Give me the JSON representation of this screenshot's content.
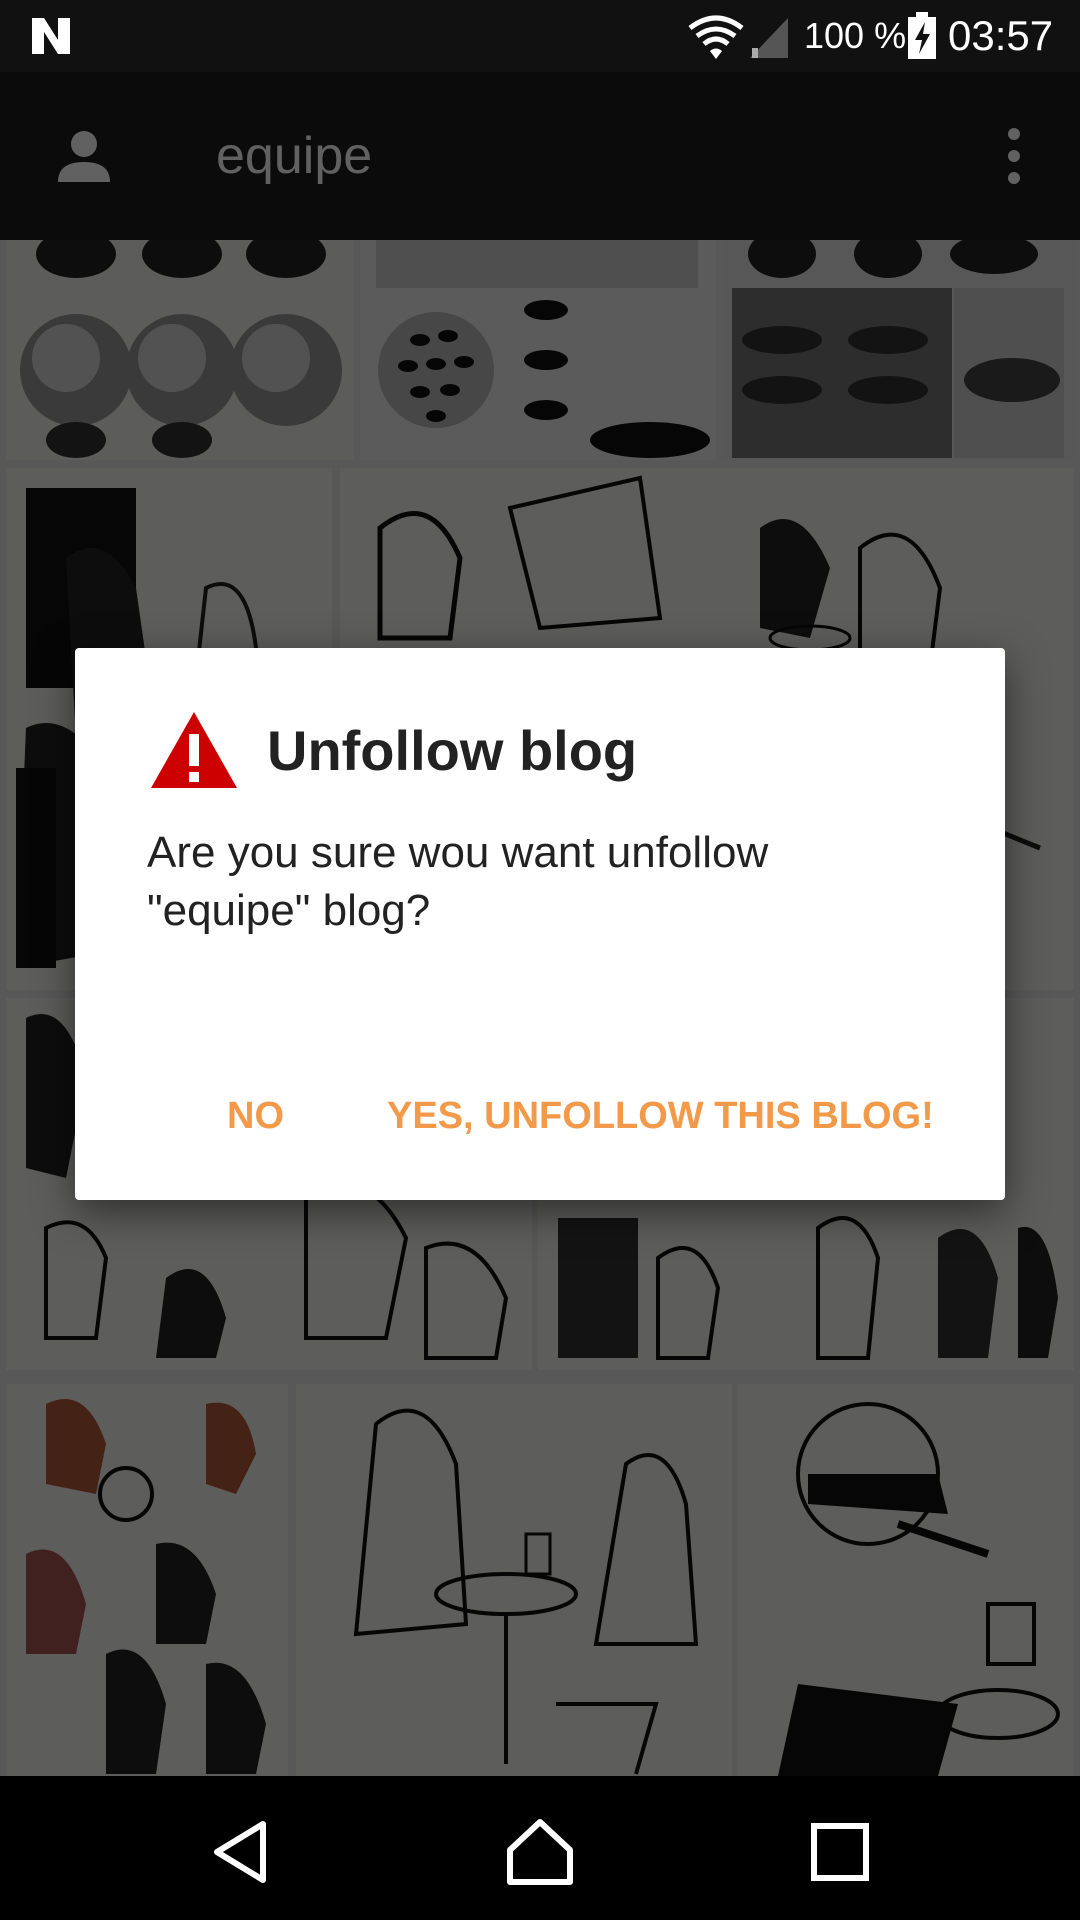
{
  "status_bar": {
    "battery_percent": "100 %",
    "time": "03:57",
    "icons": [
      "n-logo-icon",
      "wifi-icon",
      "signal-icon",
      "battery-charging-icon"
    ]
  },
  "app_bar": {
    "title": "equipe",
    "icons": [
      "account-icon",
      "more-vert-icon"
    ]
  },
  "dialog": {
    "icon": "warning-icon",
    "title": "Unfollow blog",
    "message": "Are you sure wou want unfollow \"equipe\" blog?",
    "buttons": {
      "no": "NO",
      "yes": "YES, UNFOLLOW THIS BLOG!"
    },
    "accent_color": "#f29a4a",
    "warning_color": "#cc0000"
  },
  "grid": {
    "tiles": [
      {
        "subject": "sphere-shading-study"
      },
      {
        "subject": "dotted-sphere-study"
      },
      {
        "subject": "dimpled-sphere-study"
      },
      {
        "subject": "sketch-people-portraits"
      },
      {
        "subject": "sketch-cafe-scene"
      },
      {
        "subject": "sketch-street-figures"
      },
      {
        "subject": "sketch-bar-scene"
      },
      {
        "subject": "sketch-red-ink-portraits"
      },
      {
        "subject": "sketch-couple-table"
      },
      {
        "subject": "sketch-man-drinking"
      }
    ]
  },
  "nav_bar": {
    "icons": [
      "back-icon",
      "home-icon",
      "recents-icon"
    ]
  }
}
